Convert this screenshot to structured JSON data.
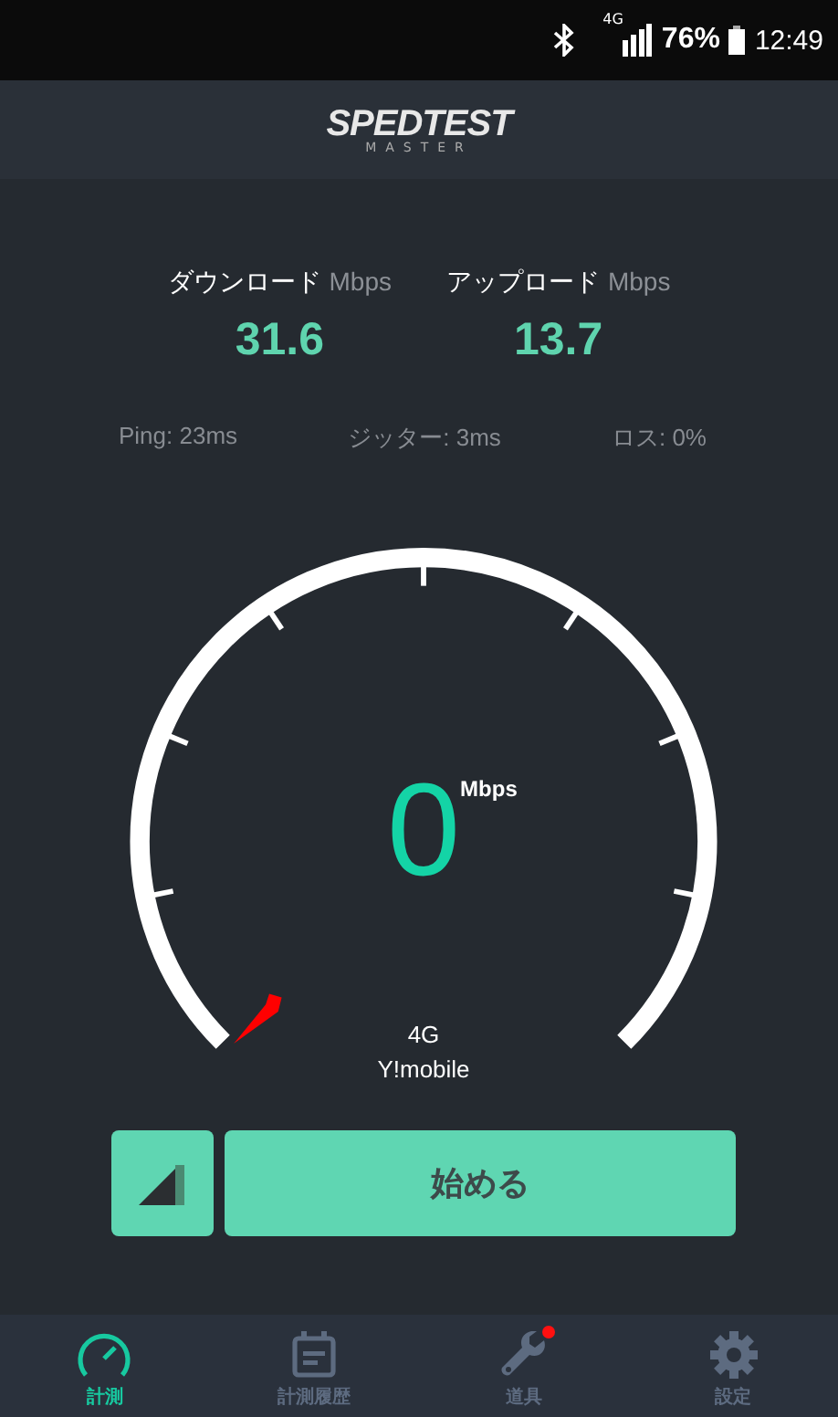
{
  "status_bar": {
    "network": "4G",
    "battery": "76%",
    "time": "12:49"
  },
  "header": {
    "logo_main": "SPEDTEST",
    "logo_sub": "MASTER"
  },
  "results": [
    {
      "label": "ダウンロード",
      "unit": "Mbps",
      "value": "31.6"
    },
    {
      "label": "アップロード",
      "unit": "Mbps",
      "value": "13.7"
    }
  ],
  "stats": [
    "Ping: 23ms",
    "ジッター: 3ms",
    "ロス: 0%"
  ],
  "gauge": {
    "value": "0",
    "unit": "Mbps",
    "network": "4G",
    "carrier": "Y!mobile"
  },
  "start_button": "始める",
  "nav": [
    {
      "label": "計測",
      "selected": true,
      "badge": false
    },
    {
      "label": "計測履歴",
      "selected": false,
      "badge": false
    },
    {
      "label": "道具",
      "selected": false,
      "badge": true
    },
    {
      "label": "設定",
      "selected": false,
      "badge": false
    }
  ]
}
